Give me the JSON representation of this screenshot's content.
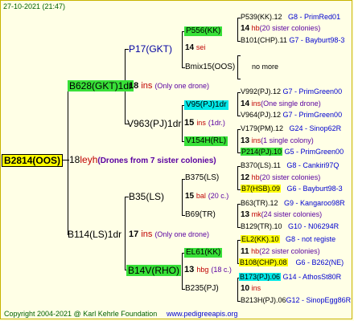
{
  "header": {
    "date": "27-10-2021 (21:47)"
  },
  "footer": {
    "copyright": "Copyright 2004-2021 @ Karl Kehrle Foundation",
    "site": "www.pedigreeapis.org"
  },
  "root": {
    "id": "B2814(OOS)",
    "gen": "18",
    "breeder": "leyh",
    "note": "(Drones from 7 sister colonies)"
  },
  "g1": [
    {
      "id": "B628(GKT)1dr",
      "gen": "18",
      "breeder": "ins",
      "note": "(Only one drone)"
    },
    {
      "id": "B114(LS)1dr",
      "gen": "17",
      "breeder": "ins",
      "note": "(Only one drone)"
    }
  ],
  "g2": [
    {
      "id": "P17(GKT)"
    },
    {
      "id": "V963(PJ)1dr",
      "gen": "15",
      "breeder": "ins",
      "note": "(1dr.)"
    },
    {
      "id": "B35(LS)"
    },
    {
      "id": "B14V(RHO)",
      "gen": "13",
      "breeder": "hbg",
      "note": "(18 c.)"
    }
  ],
  "g3": [
    {
      "id": "P556(KK)",
      "gen": "14",
      "breeder": "sei"
    },
    {
      "id": "Bmix15(OOS)"
    },
    {
      "id": "V95(PJ)1dr"
    },
    {
      "id": "V154H(RL)",
      "gen": "13",
      "breeder": "ins"
    },
    {
      "id": "B375(LS)",
      "gen": "15",
      "breeder": "bal",
      "note": "(20 c.)"
    },
    {
      "id": "B69(TR)"
    },
    {
      "id": "EL61(KK)",
      "gen": "13",
      "breeder": "hbg",
      "note": "(18 c.)"
    },
    {
      "id": "B235(PJ)"
    }
  ],
  "g4": [
    {
      "line1": "P539(KK).12",
      "line1b": "G8 - PrimRed01",
      "line2gen": "14",
      "line2b": "hb",
      "line2c": "(20 sister colonies)",
      "line3": "B101(CHP).11",
      "line3b": "G7 - Bayburt98-3"
    },
    {
      "nomore": "no more"
    },
    {
      "line1": "V992(PJ).12",
      "line1b": "G7 - PrimGreen00",
      "line2gen": "14",
      "line2b": "ins",
      "line2c": "(One single drone)",
      "line3": "V964(PJ).12",
      "line3b": "G7 - PrimGreen00"
    },
    {
      "line1": "V179(PM).12",
      "line1b": "G24 - Sinop62R",
      "line2gen": "13",
      "line2b": "ins",
      "line2c": "(1 single colony)",
      "line3": "P214(PJ).10",
      "line3b": "G5 - PrimGreen00"
    },
    {
      "line1": "B370(LS).11",
      "line1b": "G8 - Cankiri97Q",
      "line2gen": "12",
      "line2b": "hb",
      "line2c": "(20 sister colonies)",
      "line3": "B7(HSB).09",
      "line3b": "G6 - Bayburt98-3"
    },
    {
      "line1": "B63(TR).12",
      "line1b": "G9 - Kangaroo98R",
      "line2gen": "13",
      "line2b": "mk",
      "line2c": "(24 sister colonies)",
      "line3": "B129(TR).10",
      "line3b": "G10 - N06294R"
    },
    {
      "line1": "EL2(KK).10",
      "line1b": "G8 - not registe",
      "line2gen": "11",
      "line2b": "hb",
      "line2c": "(22 sister colonies)",
      "line3": "B108(CHP).08",
      "line3b": "G6 - B262(NE)"
    },
    {
      "line1": "B173(PJ).06",
      "line1b": "G14 - AthosSt80R",
      "line2gen": "10",
      "line2b": "ins",
      "line2c": "",
      "line3": "B213H(PJ).06",
      "line3b": "G12 - SinopEgg86R"
    }
  ]
}
